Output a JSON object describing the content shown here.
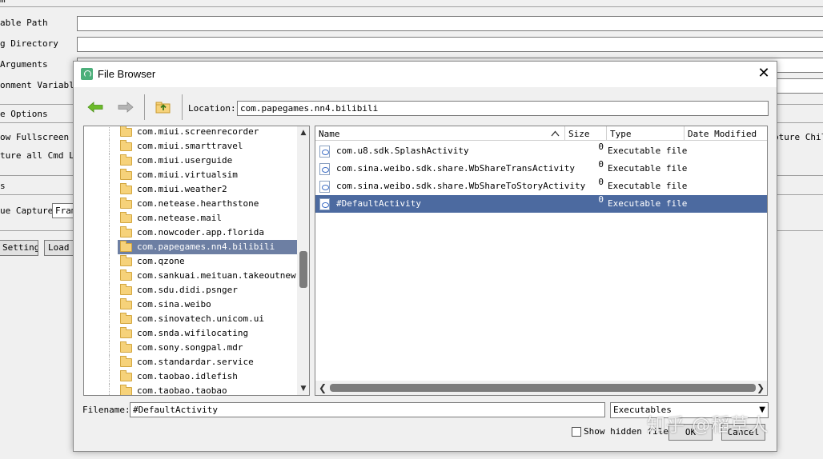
{
  "background": {
    "labels": [
      "able Path",
      "g Directory",
      " Arguments",
      "onment Variables",
      "e Options",
      "ow Fullscreen",
      "ture all Cmd Lis",
      "s",
      "ue Capture"
    ],
    "capture_combo": "Fram",
    "right_label": "pture Chil",
    "settings_button": "Settings",
    "load_button": "Load S"
  },
  "dialog": {
    "title": "File Browser",
    "location_label": "Location:",
    "location_value": "com.papegames.nn4.bilibili",
    "tree": {
      "items": [
        {
          "label": "com.miui.screenrecorder",
          "selected": false
        },
        {
          "label": "com.miui.smarttravel",
          "selected": false
        },
        {
          "label": "com.miui.userguide",
          "selected": false
        },
        {
          "label": "com.miui.virtualsim",
          "selected": false
        },
        {
          "label": "com.miui.weather2",
          "selected": false
        },
        {
          "label": "com.netease.hearthstone",
          "selected": false
        },
        {
          "label": "com.netease.mail",
          "selected": false
        },
        {
          "label": "com.nowcoder.app.florida",
          "selected": false
        },
        {
          "label": "com.papegames.nn4.bilibili",
          "selected": true
        },
        {
          "label": "com.qzone",
          "selected": false
        },
        {
          "label": "com.sankuai.meituan.takeoutnew",
          "selected": false
        },
        {
          "label": "com.sdu.didi.psnger",
          "selected": false
        },
        {
          "label": "com.sina.weibo",
          "selected": false
        },
        {
          "label": "com.sinovatech.unicom.ui",
          "selected": false
        },
        {
          "label": "com.snda.wifilocating",
          "selected": false
        },
        {
          "label": "com.sony.songpal.mdr",
          "selected": false
        },
        {
          "label": "com.standardar.service",
          "selected": false
        },
        {
          "label": "com.taobao.idlefish",
          "selected": false
        },
        {
          "label": "com.taobao.taobao",
          "selected": false
        }
      ]
    },
    "files": {
      "columns": [
        "Name",
        "Size",
        "Type",
        "Date Modified"
      ],
      "rows": [
        {
          "name": "com.u8.sdk.SplashActivity",
          "size": "0",
          "type": "Executable file",
          "selected": false
        },
        {
          "name": "com.sina.weibo.sdk.share.WbShareTransActivity",
          "size": "0",
          "type": "Executable file",
          "selected": false
        },
        {
          "name": "com.sina.weibo.sdk.share.WbShareToStoryActivity",
          "size": "0",
          "type": "Executable file",
          "selected": false
        },
        {
          "name": "#DefaultActivity",
          "size": "0",
          "type": "Executable file",
          "selected": true
        }
      ]
    },
    "filename_label": "Filename:",
    "filename_value": "#DefaultActivity",
    "filter_value": "Executables",
    "show_hidden_label": "Show hidden files",
    "ok_label": "OK",
    "cancel_label": "Cancel"
  },
  "watermark": "知乎 @稻草人",
  "colors": {
    "selection": "#4c6aa0",
    "tree_selection": "#6d7fa3",
    "back_arrow": "#6cbb2a",
    "forward_arrow": "#9a9a9a",
    "folder": "#f6d27a"
  }
}
